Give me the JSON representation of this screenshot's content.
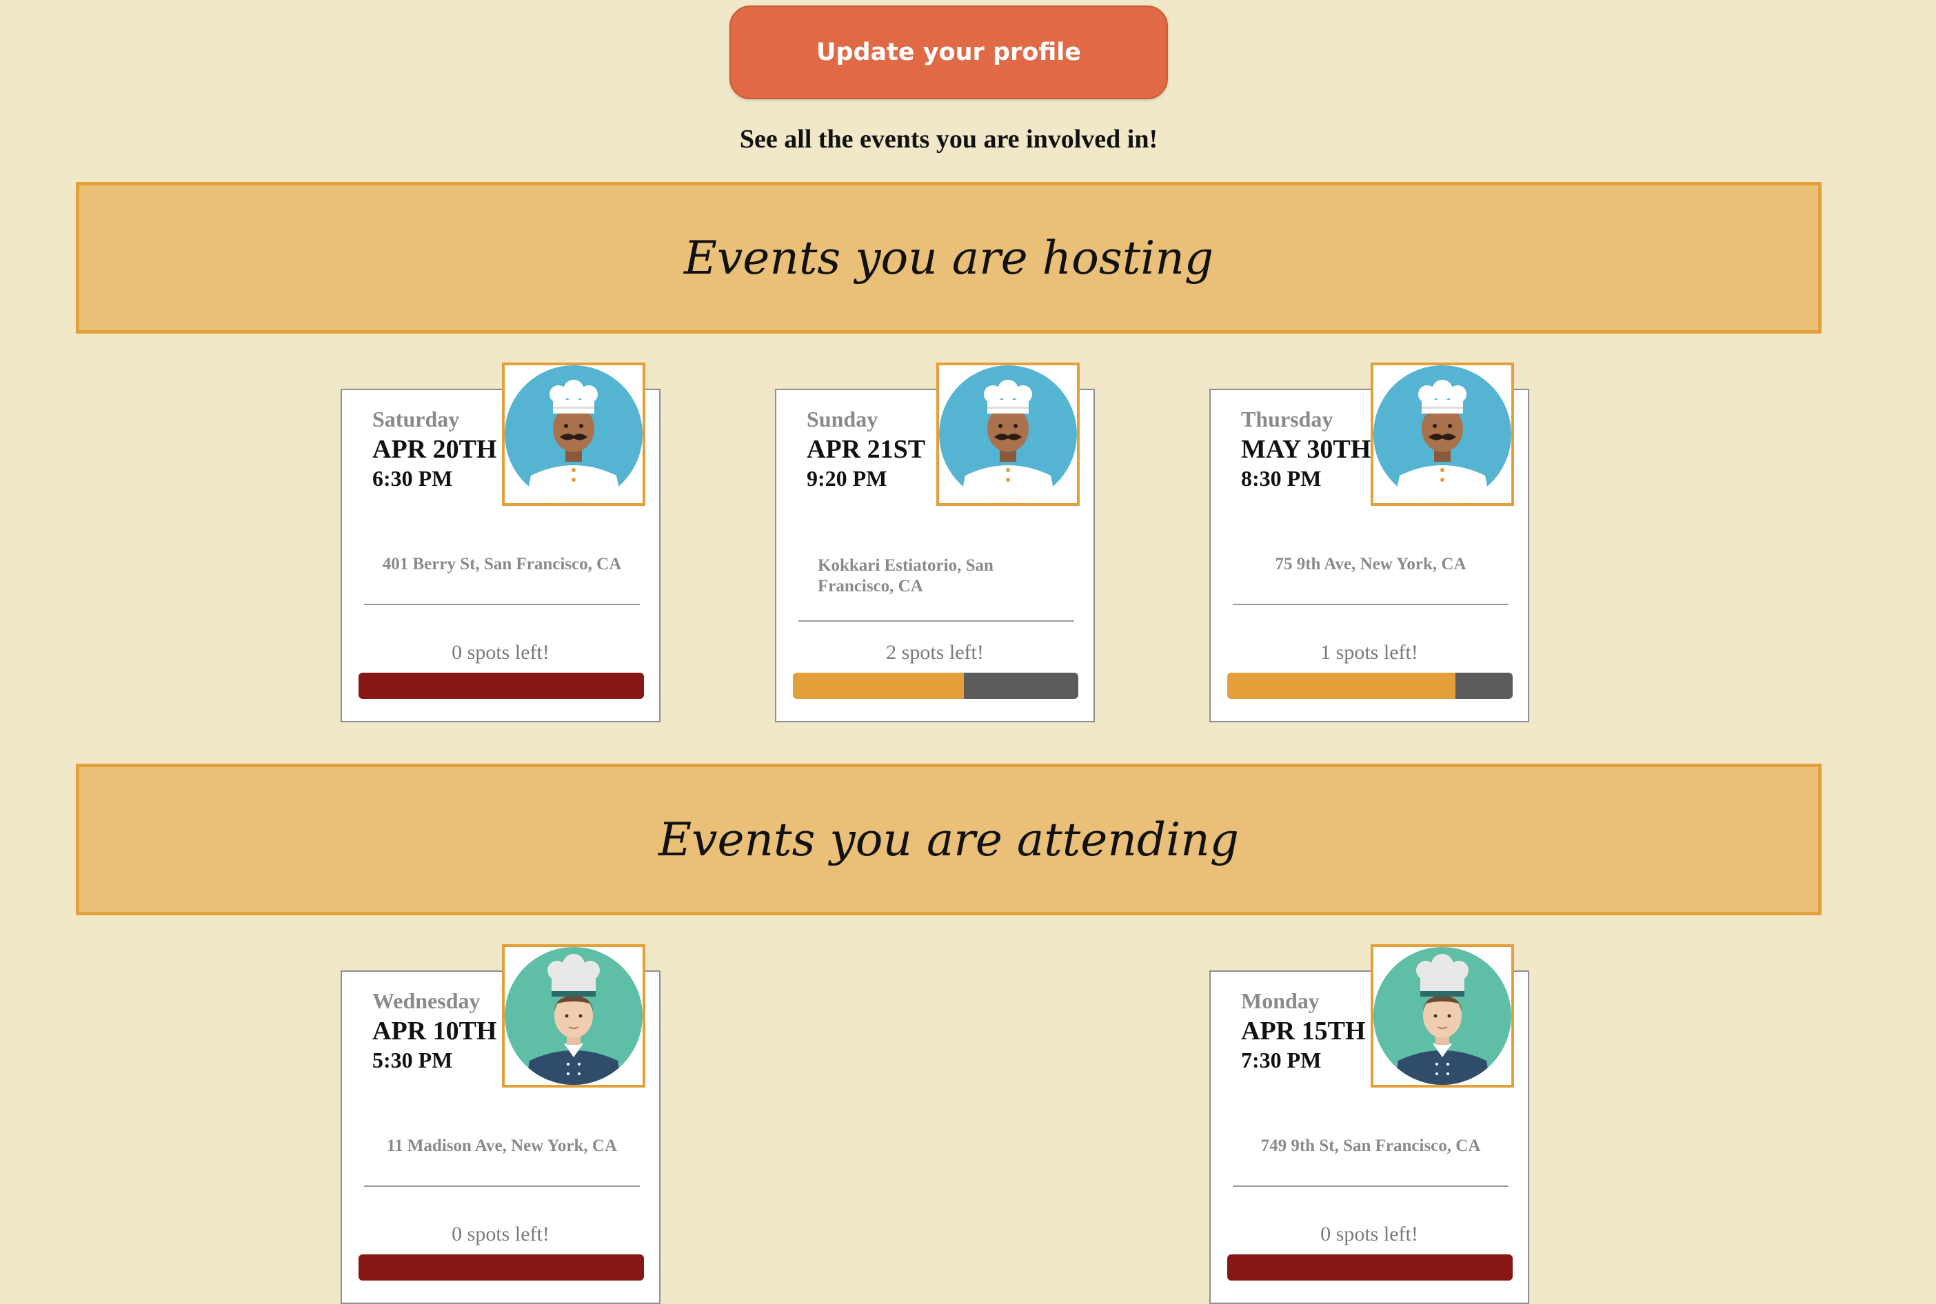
{
  "header": {
    "update_button": "Update your profile",
    "subtitle": "See all the events you are involved in!"
  },
  "hosting": {
    "title": "Events you are hosting",
    "events": [
      {
        "day": "Saturday",
        "date": "APR 20TH",
        "time": "6:30 PM",
        "address": "401 Berry St, San Francisco, CA",
        "spots": "0 spots left!",
        "fill": 1.0,
        "avatar": "chef-mustache-avatar-icon"
      },
      {
        "day": "Sunday",
        "date": "APR 21ST",
        "time": "9:20 PM",
        "address": "Kokkari Estiatorio, San Francisco, CA",
        "spots": "2 spots left!",
        "fill": 0.6,
        "avatar": "chef-mustache-avatar-icon"
      },
      {
        "day": "Thursday",
        "date": "MAY 30TH",
        "time": "8:30 PM",
        "address": "75 9th Ave, New York, CA",
        "spots": "1 spots left!",
        "fill": 0.8,
        "avatar": "chef-mustache-avatar-icon"
      }
    ]
  },
  "attending": {
    "title": "Events you are attending",
    "events": [
      {
        "day": "Wednesday",
        "date": "APR 10TH",
        "time": "5:30 PM",
        "address": "11 Madison Ave, New York, CA",
        "spots": "0 spots left!",
        "fill": 1.0,
        "avatar": "chef-young-avatar-icon"
      },
      {
        "day": "Monday",
        "date": "APR 15TH",
        "time": "7:30 PM",
        "address": "749 9th St, San Francisco, CA",
        "spots": "0 spots left!",
        "fill": 1.0,
        "avatar": "chef-young-avatar-icon"
      }
    ]
  },
  "colors": {
    "background": "#f1e7c9",
    "button": "#e06a45",
    "banner": "#eac078",
    "banner_border": "#e3a03a",
    "bar_fill": "#e3a03a",
    "bar_track": "#5c5c5c",
    "bar_full": "#861714"
  }
}
